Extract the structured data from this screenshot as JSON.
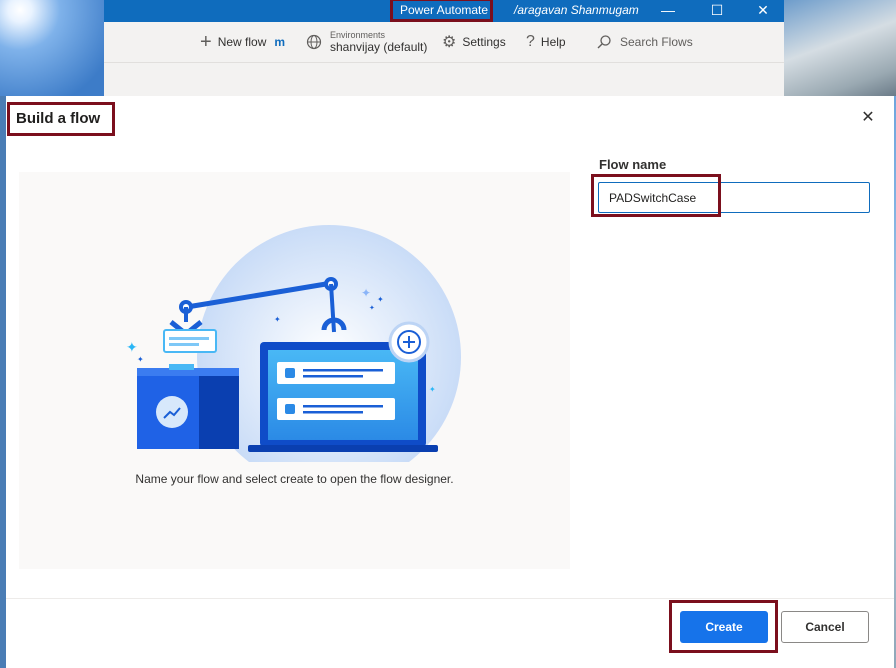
{
  "app": {
    "title": "Power Automate",
    "user": "/aragavan Shanmugam",
    "window_controls": {
      "minimize": "—",
      "maximize": "☐",
      "close": "✕"
    }
  },
  "toolbar": {
    "new_flow": "New flow",
    "new_flow_suffix": "m",
    "environments_label": "Environments",
    "environment_value": "shanvijay (default)",
    "settings": "Settings",
    "help": "Help",
    "search": "Search Flows"
  },
  "dialog": {
    "title": "Build a flow",
    "close": "✕",
    "caption": "Name your flow and select create to open the flow designer.",
    "flow_name_label": "Flow name",
    "flow_name_value": "PADSwitchCase",
    "create_label": "Create",
    "cancel_label": "Cancel"
  },
  "colors": {
    "brand": "#0f6cbd",
    "highlight": "#7b0f1d",
    "primary_button": "#1673ea"
  }
}
